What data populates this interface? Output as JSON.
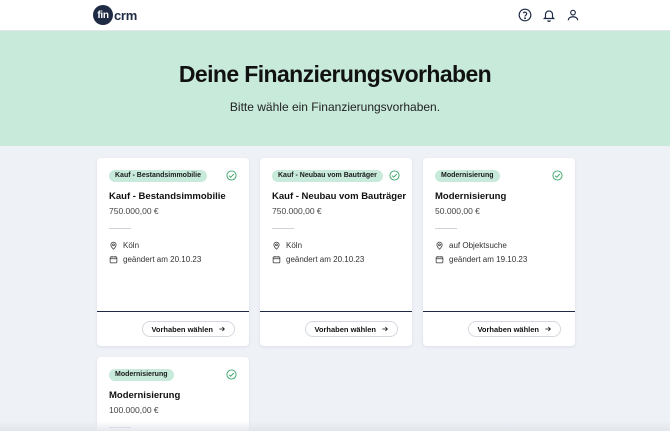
{
  "header": {
    "logo_badge": "fin",
    "logo_text": "crm",
    "icons": [
      "help-icon",
      "bell-icon",
      "user-icon"
    ]
  },
  "hero": {
    "title": "Deine Finanzierungsvorhaben",
    "subtitle": "Bitte wähle ein Finanzierungsvorhaben."
  },
  "colors": {
    "hero_bg": "#c7eadb",
    "tag_bg": "#c7eadb",
    "check_green": "#3aa66a",
    "page_bg": "#eef1f6",
    "navy": "#1f2a44"
  },
  "cards": [
    {
      "tag": "Kauf - Bestandsimmobilie",
      "title": "Kauf - Bestandsimmobilie",
      "price": "750.000,00 €",
      "location": "Köln",
      "date": "geändert am 20.10.23",
      "button": "Vorhaben wählen"
    },
    {
      "tag": "Kauf - Neubau vom Bauträger",
      "title": "Kauf - Neubau vom Bauträger",
      "price": "750.000,00 €",
      "location": "Köln",
      "date": "geändert am 20.10.23",
      "button": "Vorhaben wählen"
    },
    {
      "tag": "Modernisierung",
      "title": "Modernisierung",
      "price": "50.000,00 €",
      "location": "auf Objektsuche",
      "date": "geändert am 19.10.23",
      "button": "Vorhaben wählen"
    },
    {
      "tag": "Modernisierung",
      "title": "Modernisierung",
      "price": "100.000,00 €"
    }
  ]
}
